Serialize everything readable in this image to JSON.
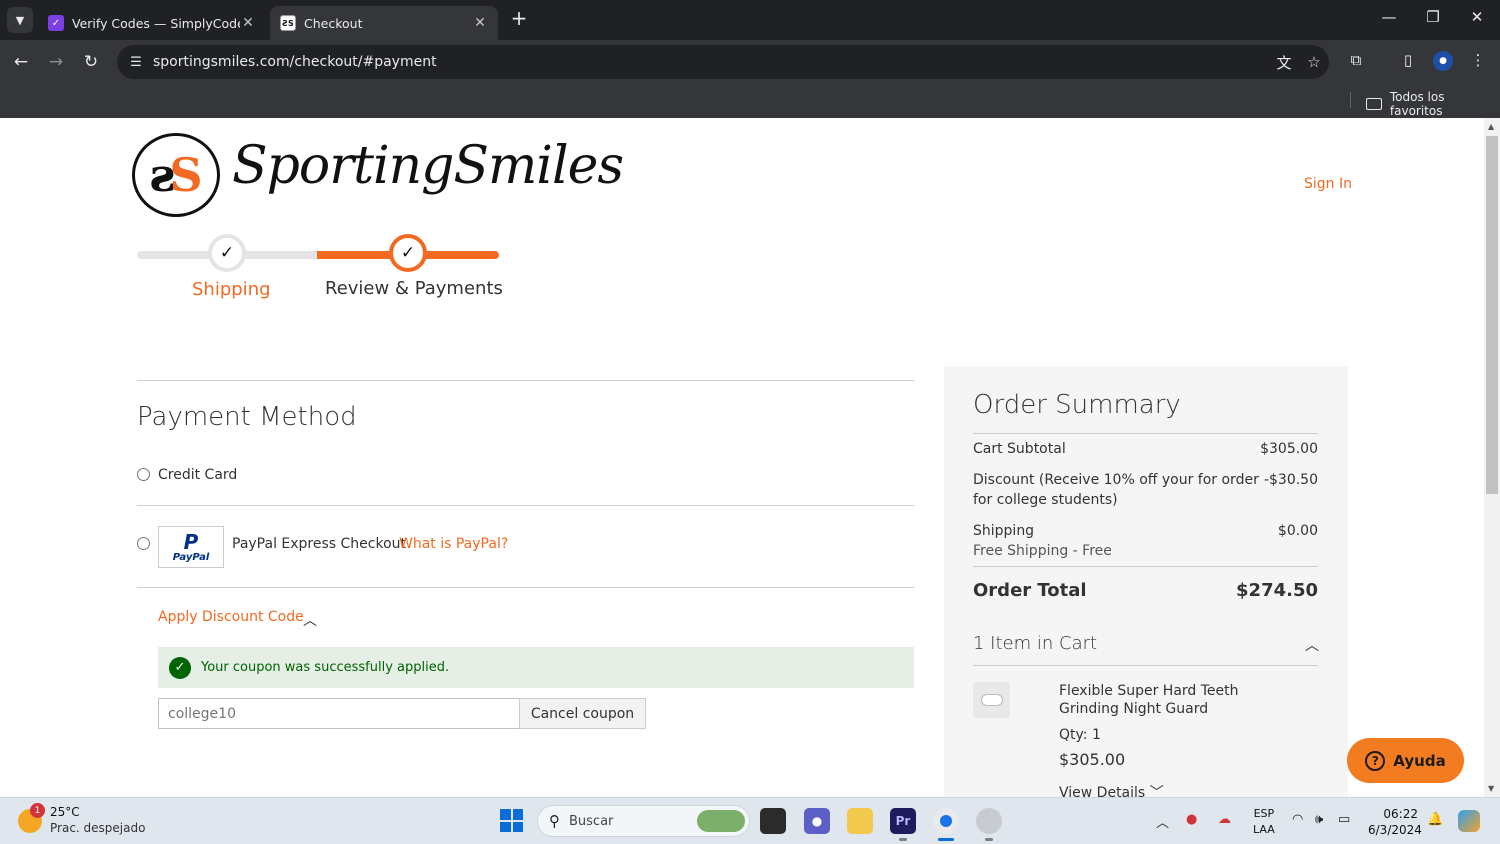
{
  "browser": {
    "tabs": [
      {
        "title": "Verify Codes — SimplyCodes",
        "active": false
      },
      {
        "title": "Checkout",
        "active": true
      }
    ],
    "url": "sportingsmiles.com/checkout/#payment",
    "bookmarks_all": "Todos los favoritos"
  },
  "header": {
    "logo_text": "SportingSmiles",
    "sign_in": "Sign In"
  },
  "progress": {
    "steps": [
      {
        "label": "Shipping",
        "state": "done"
      },
      {
        "label": "Review & Payments",
        "state": "current"
      }
    ]
  },
  "payment": {
    "title": "Payment Method",
    "options": [
      {
        "label": "Credit Card"
      },
      {
        "label": "PayPal Express Checkout",
        "link": "What is PayPal?",
        "logo_text": "PayPal"
      }
    ],
    "discount_toggle": "Apply Discount Code",
    "success_message": "Your coupon was successfully applied.",
    "coupon_placeholder": "college10",
    "cancel_label": "Cancel coupon"
  },
  "summary": {
    "title": "Order Summary",
    "rows": [
      {
        "label": "Cart Subtotal",
        "value": "$305.00"
      },
      {
        "label": "Discount (Receive 10% off your for order for college students)",
        "value": "-$30.50"
      },
      {
        "label": "Shipping",
        "sub": "Free Shipping - Free",
        "value": "$0.00"
      }
    ],
    "total_label": "Order Total",
    "total_value": "$274.50",
    "items_in_cart": "1 Item in Cart",
    "item": {
      "name": "Flexible Super Hard Teeth Grinding Night Guard",
      "qty": "Qty: 1",
      "price": "$305.00",
      "details": "View Details"
    }
  },
  "help": {
    "label": "Ayuda"
  },
  "taskbar": {
    "weather_temp": "25°C",
    "weather_desc": "Prac. despejado",
    "weather_badge": "1",
    "search": "Buscar",
    "lang_1": "ESP",
    "lang_2": "LAA",
    "time": "06:22",
    "date": "6/3/2024"
  },
  "colors": {
    "accent": "#f26a21",
    "success": "#006400",
    "success_bg": "#e5efe5"
  }
}
